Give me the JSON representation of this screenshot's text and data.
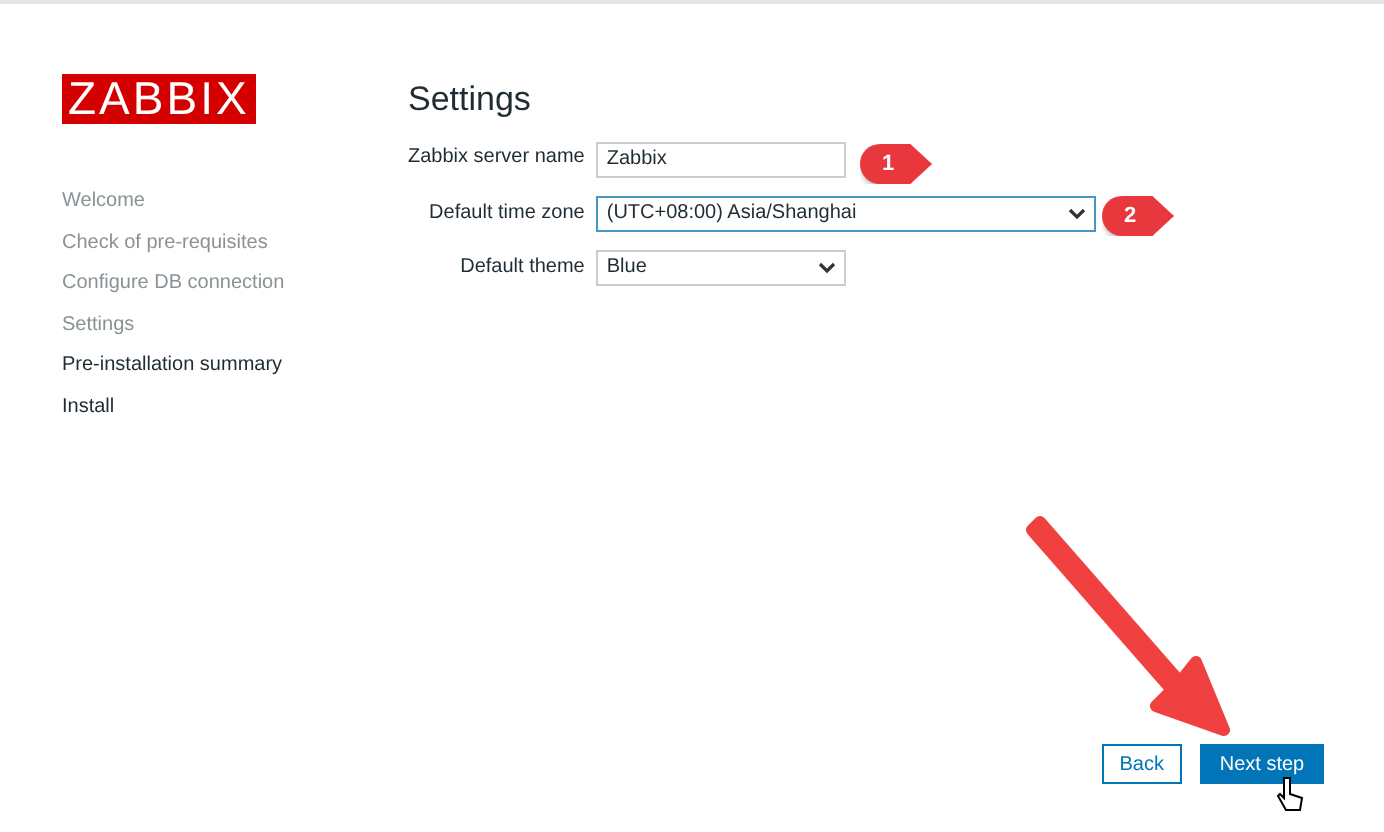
{
  "logo": "ZABBIX",
  "steps": [
    {
      "label": "Welcome",
      "done": true
    },
    {
      "label": "Check of pre-requisites",
      "done": true
    },
    {
      "label": "Configure DB connection",
      "done": true
    },
    {
      "label": "Settings",
      "done": true
    },
    {
      "label": "Pre-installation summary",
      "done": false
    },
    {
      "label": "Install",
      "done": false
    }
  ],
  "title": "Settings",
  "fields": [
    {
      "label": "Zabbix server name",
      "kind": "text",
      "value": "Zabbix",
      "focused": false
    },
    {
      "label": "Default time zone",
      "kind": "select",
      "value": "(UTC+08:00) Asia/Shanghai",
      "focused": true
    },
    {
      "label": "Default theme",
      "kind": "select",
      "value": "Blue",
      "focused": false
    }
  ],
  "callouts": [
    "1",
    "2"
  ],
  "buttons": [
    {
      "label": "Back",
      "kind": "secondary"
    },
    {
      "label": "Next step",
      "kind": "primary"
    }
  ]
}
